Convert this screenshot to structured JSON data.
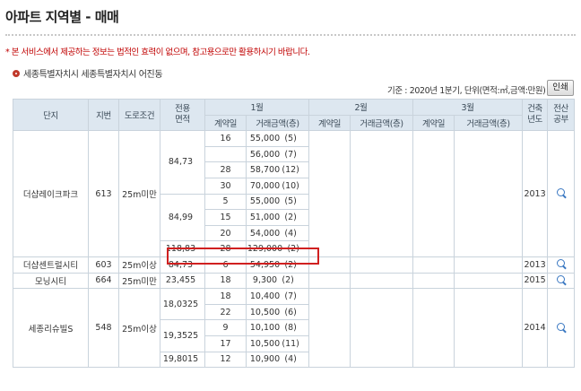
{
  "page": {
    "title": "아파트 지역별 - 매매",
    "notice": "* 본 서비스에서 제공하는 정보는 법적인 효력이 없으며, 참고용으로만 활용하시기 바랍니다.",
    "location": "세종특별자치시 세종특별자치시 어진동",
    "unit_info": "기준 : 2020년 1분기, 단위(면적:㎡,금액:만원)",
    "print_label": "인쇄"
  },
  "headers": {
    "complex": "단지",
    "lot": "지번",
    "road": "도로조건",
    "area": "전용\n면적",
    "month1": "1월",
    "month2": "2월",
    "month3": "3월",
    "contract_day": "계약일",
    "price_floor": "거래금액(층)",
    "built_year": "건축\n년도",
    "register": "전산\n공부"
  },
  "rows": [
    {
      "complex": "더샵레이크파크",
      "lot": "613",
      "road": "25m미만",
      "area": "84,73",
      "day": "16",
      "price": "55,000",
      "floor": "(5)",
      "year": "2013"
    },
    {
      "day": "",
      "price": "56,000",
      "floor": "(7)"
    },
    {
      "day": "28",
      "price": "58,700",
      "floor": "(12)"
    },
    {
      "day": "30",
      "price": "70,000",
      "floor": "(10)"
    },
    {
      "area": "84,99",
      "day": "5",
      "price": "55,000",
      "floor": "(5)"
    },
    {
      "day": "15",
      "price": "51,000",
      "floor": "(2)"
    },
    {
      "day": "20",
      "price": "54,000",
      "floor": "(4)"
    },
    {
      "area": "118,83",
      "day": "28",
      "price": "129,000",
      "floor": "(2)"
    },
    {
      "complex": "더샵센트럴시티",
      "lot": "603",
      "road": "25m이상",
      "area": "84,73",
      "day": "6",
      "price": "54,950",
      "floor": "(2)",
      "year": "2013"
    },
    {
      "complex": "모닝시티",
      "lot": "664",
      "road": "25m미만",
      "area": "23,455",
      "day": "18",
      "price": "9,300",
      "floor": "(2)",
      "year": "2015"
    },
    {
      "complex": "세종리슈빌S",
      "lot": "548",
      "road": "25m이상",
      "area": "18,0325",
      "day": "18",
      "price": "10,400",
      "floor": "(7)",
      "year": "2014"
    },
    {
      "day": "22",
      "price": "10,500",
      "floor": "(6)"
    },
    {
      "area": "19,3525",
      "day": "9",
      "price": "10,100",
      "floor": "(8)"
    },
    {
      "day": "17",
      "price": "10,500",
      "floor": "(11)"
    },
    {
      "area": "19,8015",
      "day": "12",
      "price": "10,900",
      "floor": "(4)"
    }
  ]
}
